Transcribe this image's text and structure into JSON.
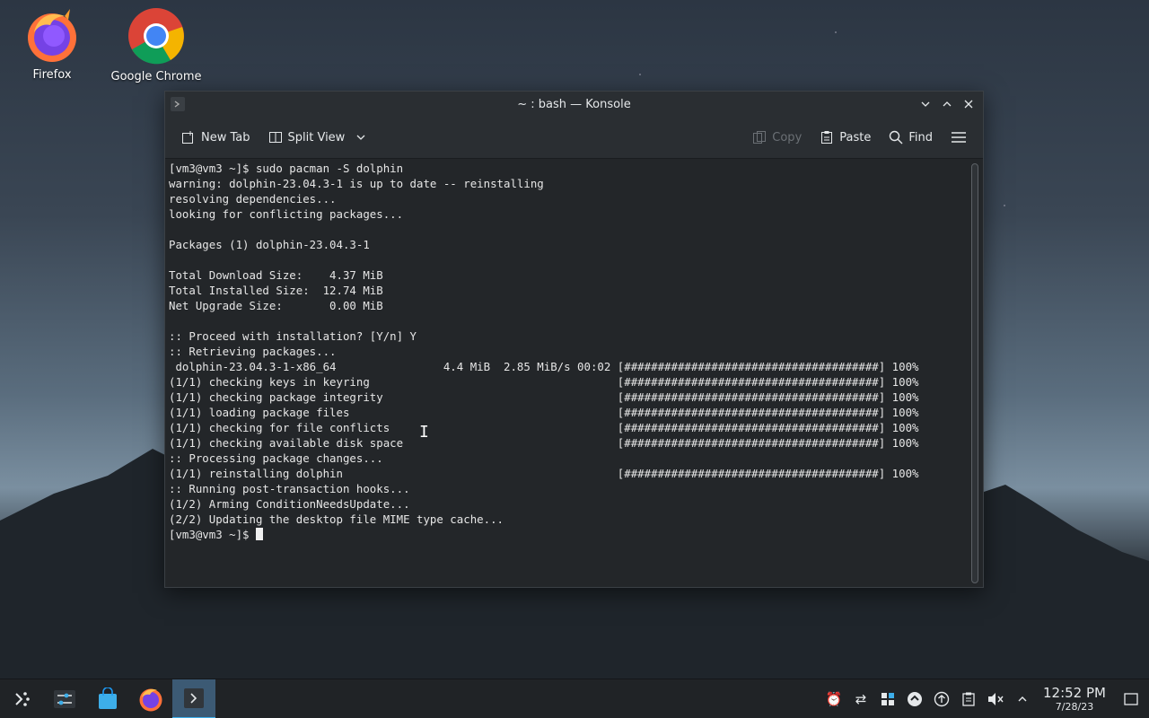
{
  "desktop": {
    "icons": [
      {
        "label": "Firefox"
      },
      {
        "label": "Google Chrome"
      }
    ]
  },
  "window": {
    "title": "~ : bash — Konsole",
    "toolbar": {
      "new_tab": "New Tab",
      "split_view": "Split View",
      "copy": "Copy",
      "paste": "Paste",
      "find": "Find"
    },
    "terminal_lines": [
      "[vm3@vm3 ~]$ sudo pacman -S dolphin",
      "warning: dolphin-23.04.3-1 is up to date -- reinstalling",
      "resolving dependencies...",
      "looking for conflicting packages...",
      "",
      "Packages (1) dolphin-23.04.3-1",
      "",
      "Total Download Size:    4.37 MiB",
      "Total Installed Size:  12.74 MiB",
      "Net Upgrade Size:       0.00 MiB",
      "",
      ":: Proceed with installation? [Y/n] Y",
      ":: Retrieving packages...",
      " dolphin-23.04.3-1-x86_64                4.4 MiB  2.85 MiB/s 00:02 [######################################] 100%",
      "(1/1) checking keys in keyring                                     [######################################] 100%",
      "(1/1) checking package integrity                                   [######################################] 100%",
      "(1/1) loading package files                                        [######################################] 100%",
      "(1/1) checking for file conflicts                                  [######################################] 100%",
      "(1/1) checking available disk space                                [######################################] 100%",
      ":: Processing package changes...",
      "(1/1) reinstalling dolphin                                         [######################################] 100%",
      ":: Running post-transaction hooks...",
      "(1/2) Arming ConditionNeedsUpdate...",
      "(2/2) Updating the desktop file MIME type cache..."
    ],
    "prompt": "[vm3@vm3 ~]$ "
  },
  "taskbar": {
    "clock_time": "12:52 PM",
    "clock_date": "7/28/23"
  },
  "colors": {
    "accent": "#3daee9",
    "terminal_bg": "#232629",
    "terminal_fg": "#e6e6e6"
  }
}
